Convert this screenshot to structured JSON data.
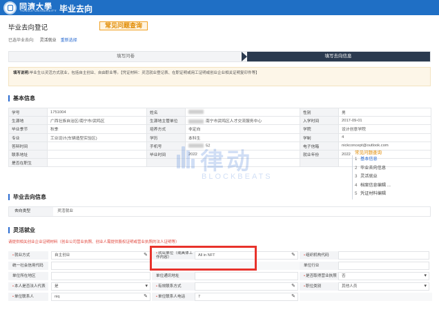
{
  "header": {
    "university_cn": "同濟大學",
    "university_en": "TONGJI UNIVERSITY",
    "app_title": "毕业去向"
  },
  "page": {
    "title": "毕业去向登记",
    "faq_button": "常见问题查询",
    "selected_label": "已选毕业去向:",
    "selected_value": "灵活就业",
    "reselect_link": "重新选择"
  },
  "steps": [
    {
      "label": "填写问卷",
      "active": false
    },
    {
      "label": "填写去向信息",
      "active": true
    }
  ],
  "notice": {
    "label": "填写说明:",
    "text": "毕业生以灵活方式就业，包括自主创业、自由职业等。【凭证材料：灵活就业登记表、在职证明或用工证明或创业企业相关证明复印件等】"
  },
  "sections": {
    "basic": "基本信息",
    "destination": "毕业去向信息",
    "flexible": "灵活就业"
  },
  "basic_info": [
    [
      {
        "k": "学号",
        "v": "1751004"
      },
      {
        "k": "姓名",
        "v": "",
        "blur": true
      },
      {
        "k": "性别",
        "v": "男"
      }
    ],
    [
      {
        "k": "生源地",
        "v": "广西壮族自治区/南宁市/武鸣区"
      },
      {
        "k": "生源地主管单位",
        "v": "南宁市武鸣区人才交流服务中心",
        "blur": true
      },
      {
        "k": "入学时间",
        "v": "2017-09-01"
      }
    ],
    [
      {
        "k": "毕业季节",
        "v": "秋季"
      },
      {
        "k": "培养方式",
        "v": "非定向"
      },
      {
        "k": "学院",
        "v": "设计创意学院"
      }
    ],
    [
      {
        "k": "专业",
        "v": "工业设计(车辆造型实验区)"
      },
      {
        "k": "学历",
        "v": "本科生"
      },
      {
        "k": "学制",
        "v": "4"
      }
    ],
    [
      {
        "k": "答辩时间",
        "v": ""
      },
      {
        "k": "手机号",
        "v": "52",
        "blur": true
      },
      {
        "k": "电子信箱",
        "v": "nickconcept@outlook.com"
      }
    ],
    [
      {
        "k": "联系地址",
        "v": ""
      },
      {
        "k": "毕业时间",
        "v": "2022"
      },
      {
        "k": "就业年份",
        "v": "2022"
      }
    ],
    [
      {
        "k": "是否在职生",
        "v": ""
      },
      {
        "k": "",
        "v": ""
      },
      {
        "k": "",
        "v": ""
      }
    ]
  ],
  "destination": {
    "label": "去向类型",
    "value": "灵活就业"
  },
  "warning": "请提供相关创业企业证明材料（创业公司营业执照、创业人需提供股权证明或营业执照的法人证明等）",
  "form": [
    [
      {
        "k": "就业方式",
        "v": "自主创业",
        "req": true,
        "icon": "✎"
      },
      {
        "k": "就业单位（或具体工作内容）",
        "v": "All in NFT",
        "req": true,
        "icon": "✎"
      },
      {
        "k": "组织机构代码",
        "v": "",
        "req": true,
        "icon": ""
      }
    ],
    [
      {
        "k": "统一社会信用代码",
        "v": "",
        "req": false,
        "icon": ""
      },
      {
        "k": "",
        "v": "",
        "req": false,
        "icon": ""
      },
      {
        "k": "单位行业",
        "v": "",
        "req": false,
        "icon": ""
      }
    ],
    [
      {
        "k": "单位所在地区",
        "v": "",
        "req": false,
        "icon": ""
      },
      {
        "k": "单位通讯地址",
        "v": "",
        "req": false,
        "icon": ""
      },
      {
        "k": "是否取得营业执照",
        "v": "否",
        "req": true,
        "icon": "▾"
      }
    ],
    [
      {
        "k": "本人是否法人代表",
        "v": "是",
        "req": true,
        "icon": "▾"
      },
      {
        "k": "有效联系方式",
        "v": "",
        "req": true,
        "icon": "✎"
      },
      {
        "k": "职位类别",
        "v": "其他人员",
        "req": true,
        "icon": "▾"
      }
    ],
    [
      {
        "k": "单位联系人",
        "v": "niq",
        "req": true,
        "icon": "✎"
      },
      {
        "k": "单位联系人电话",
        "v": "7",
        "req": true,
        "icon": "✎"
      },
      {
        "k": "",
        "v": "",
        "req": false,
        "icon": ""
      }
    ]
  ],
  "sidenav": {
    "title": "常见问题查询",
    "items": [
      {
        "num": "1",
        "label": "基本信息",
        "active": true
      },
      {
        "num": "2",
        "label": "毕业去向信息",
        "active": false
      },
      {
        "num": "3",
        "label": "灵活就业",
        "active": false
      },
      {
        "num": "4",
        "label": "档案信息编辑 ...",
        "active": false
      },
      {
        "num": "5",
        "label": "凭证材料编辑",
        "active": false
      }
    ]
  },
  "watermark": {
    "cn": "律动",
    "en": "BLOCKBEATS"
  },
  "colors": {
    "brand": "#1f6fc5",
    "highlight": "#e8322b",
    "accent": "#f0a020"
  }
}
